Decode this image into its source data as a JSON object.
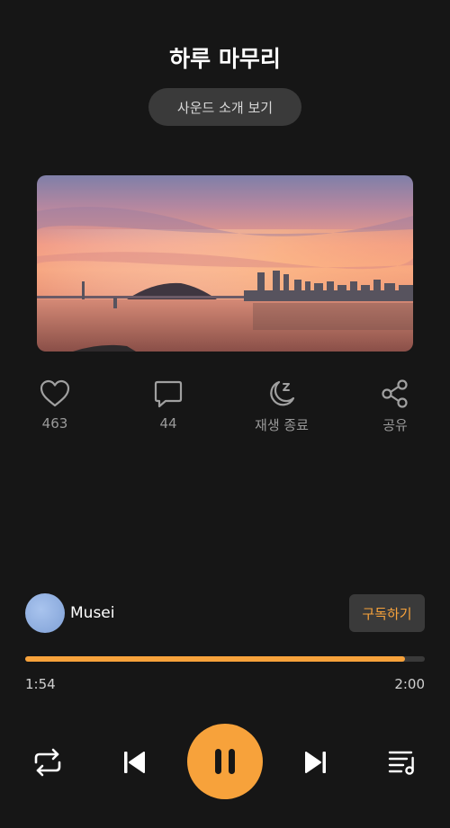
{
  "title": "하루 마무리",
  "intro_button": "사운드 소개 보기",
  "actions": {
    "like_count": "463",
    "comment_count": "44",
    "sleep_timer": "재생 종료",
    "share": "공유"
  },
  "author": {
    "name": "Musei",
    "subscribe_label": "구독하기"
  },
  "player": {
    "elapsed": "1:54",
    "duration": "2:00",
    "progress_fraction": 0.95,
    "state": "playing"
  },
  "colors": {
    "accent": "#f7a23b",
    "background": "#161616"
  },
  "icons": [
    "heart-icon",
    "comment-icon",
    "moon-sleep-icon",
    "share-icon",
    "repeat-icon",
    "previous-icon",
    "pause-icon",
    "next-icon",
    "playlist-icon"
  ]
}
